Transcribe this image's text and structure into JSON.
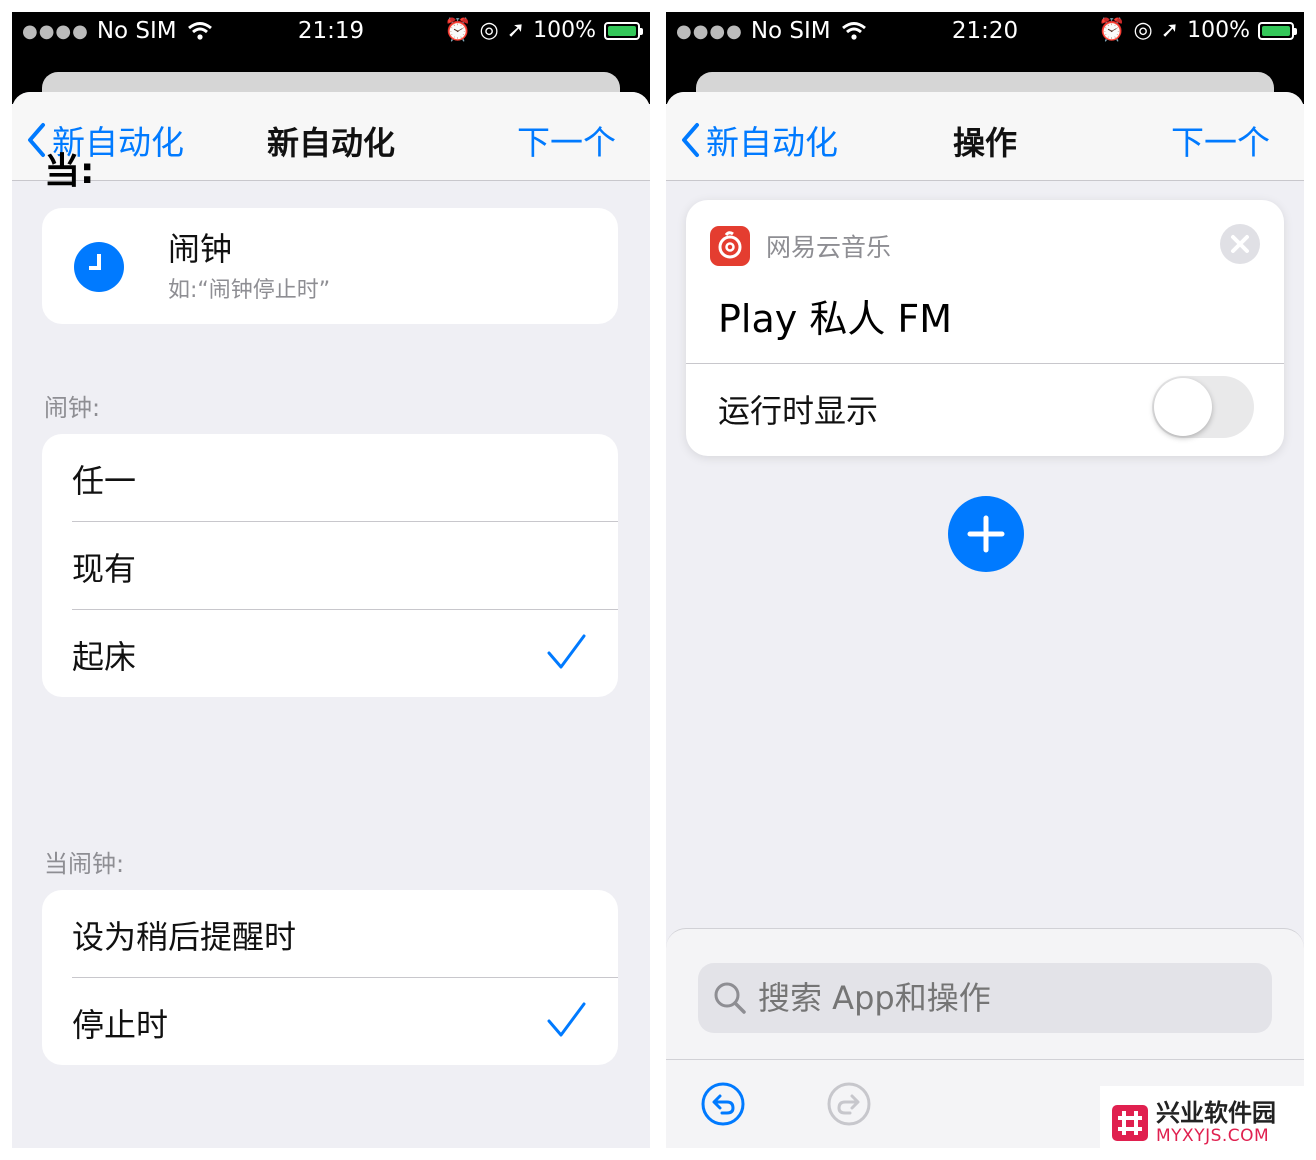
{
  "left_screen": {
    "status_bar": {
      "carrier": "No SIM",
      "time": "21:19",
      "battery": "100%"
    },
    "nav": {
      "back_label": "新自动化",
      "title": "新自动化",
      "next_label": "下一个"
    },
    "when_label": "当:",
    "trigger": {
      "title": "闹钟",
      "subtitle": "如:“闹钟停止时”"
    },
    "alarm_section": {
      "header": "闹钟:",
      "options": [
        {
          "label": "任一",
          "checked": false
        },
        {
          "label": "现有",
          "checked": false
        },
        {
          "label": "起床",
          "checked": true
        }
      ]
    },
    "when_alarm_section": {
      "header": "当闹钟:",
      "options": [
        {
          "label": "设为稍后提醒时",
          "checked": false
        },
        {
          "label": "停止时",
          "checked": true
        }
      ]
    }
  },
  "right_screen": {
    "status_bar": {
      "carrier": "No SIM",
      "time": "21:20",
      "battery": "100%"
    },
    "nav": {
      "back_label": "新自动化",
      "title": "操作",
      "next_label": "下一个"
    },
    "action_card": {
      "app_name": "网易云音乐",
      "title": "Play 私人 FM",
      "toggle_label": "运行时显示",
      "toggle_on": false
    },
    "search": {
      "placeholder": "搜索 App和操作"
    }
  },
  "watermark": {
    "cn": "兴业软件园",
    "en": "MYXYJS.COM"
  },
  "colors": {
    "accent": "#007aff",
    "background": "#efeff4",
    "app_icon": "#e43d30",
    "battery": "#34c759"
  }
}
